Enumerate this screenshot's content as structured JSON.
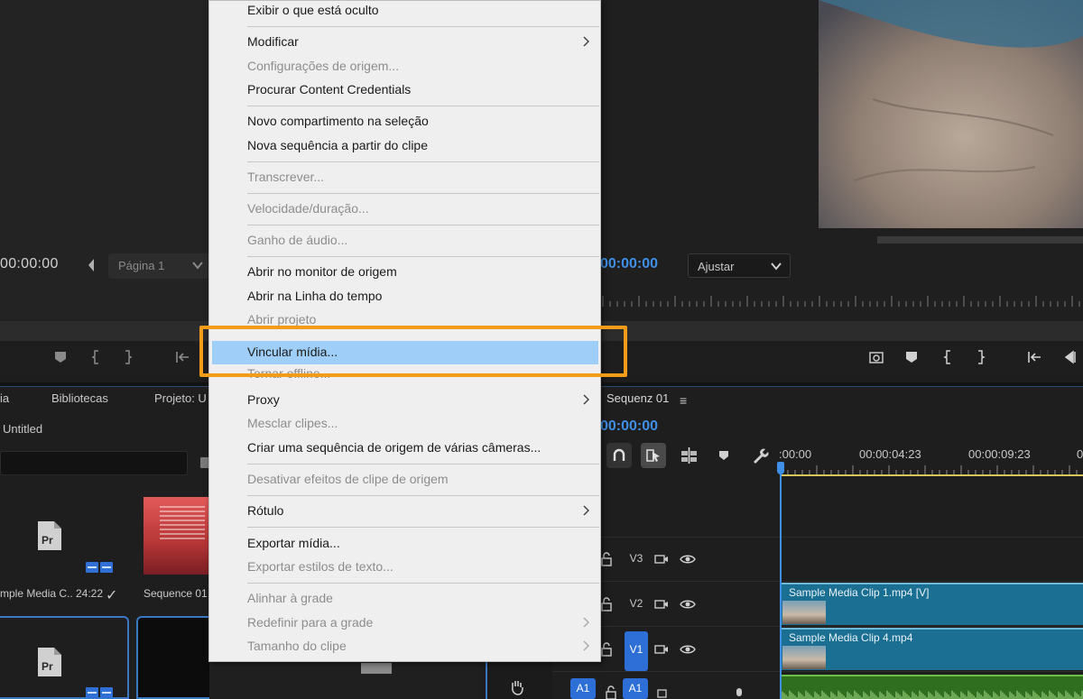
{
  "source_monitor": {
    "timecode": "00:00:00",
    "page_select": "Página 1"
  },
  "program_monitor": {
    "timecode": "00:00:00",
    "fit_select": "Ajustar"
  },
  "project_panel": {
    "tabs": [
      "ia",
      "Bibliotecas",
      "Projeto: U"
    ],
    "project_name": "Untitled",
    "items": [
      {
        "name": "mple Media C..",
        "duration": "24:22",
        "check": "✓"
      },
      {
        "name": "Sequence 01"
      }
    ]
  },
  "timeline": {
    "sequence_tab": "Sequenz 01",
    "menu_icon": "≡",
    "timecode": "00:00:00",
    "ruler_labels": [
      ":00:00",
      "00:00:04:23",
      "00:00:09:23",
      "0"
    ],
    "tracks": [
      {
        "label": "V3"
      },
      {
        "label": "V2"
      },
      {
        "label": "V1",
        "active": true
      }
    ],
    "audio_track_left": "A1",
    "audio_track": "A1",
    "clips": {
      "v2": "Sample Media Clip 1.mp4 [V]",
      "v1": "Sample Media Clip 4.mp4"
    },
    "clip_colors": {
      "video": "#1b6f93",
      "audio": "#2f6e1f"
    },
    "accent": "#3f8fe6"
  },
  "context_menu": {
    "items": [
      {
        "label": "Exibir o que está oculto",
        "disabled": false
      },
      {
        "label": "Modificar",
        "submenu": true
      },
      {
        "label": "Configurações de origem...",
        "disabled": true
      },
      {
        "label": "Procurar Content Credentials"
      },
      {
        "label": "Novo compartimento na seleção"
      },
      {
        "label": "Nova sequência a partir do clipe"
      },
      {
        "label": "Transcrever...",
        "disabled": true
      },
      {
        "label": "Velocidade/duração...",
        "disabled": true
      },
      {
        "label": "Ganho de áudio...",
        "disabled": true
      },
      {
        "label": "Abrir no monitor de origem"
      },
      {
        "label": "Abrir na Linha do tempo"
      },
      {
        "label": "Abrir projeto",
        "disabled": true
      },
      {
        "label": "Vincular mídia...",
        "highlighted": true
      },
      {
        "label": "Tornar offline...",
        "disabled": true
      },
      {
        "label": "Proxy",
        "submenu": true
      },
      {
        "label": "Mesclar clipes...",
        "disabled": true
      },
      {
        "label": "Criar uma sequência de origem de várias câmeras..."
      },
      {
        "label": "Desativar efeitos de clipe de origem",
        "disabled": true
      },
      {
        "label": "Rótulo",
        "submenu": true
      },
      {
        "label": "Exportar mídia..."
      },
      {
        "label": "Exportar estilos de texto...",
        "disabled": true
      },
      {
        "label": "Alinhar à grade",
        "disabled": true
      },
      {
        "label": "Redefinir para a grade",
        "disabled": true,
        "submenu": true
      },
      {
        "label": "Tamanho do clipe",
        "disabled": true,
        "submenu": true
      }
    ],
    "highlight_color": "#9fcff8",
    "callout_color": "#f39c1a"
  },
  "icons": [
    "chevron-left-icon",
    "chevron-down-icon",
    "marker-icon",
    "in-point-icon",
    "out-point-icon",
    "go-to-in-icon",
    "export-frame-icon",
    "snap-icon",
    "linked-selection-icon",
    "insert-icon",
    "wrench-icon",
    "lock-icon",
    "camera-icon",
    "eye-icon",
    "chevron-right-icon",
    "hand-icon",
    "microphone-icon"
  ]
}
